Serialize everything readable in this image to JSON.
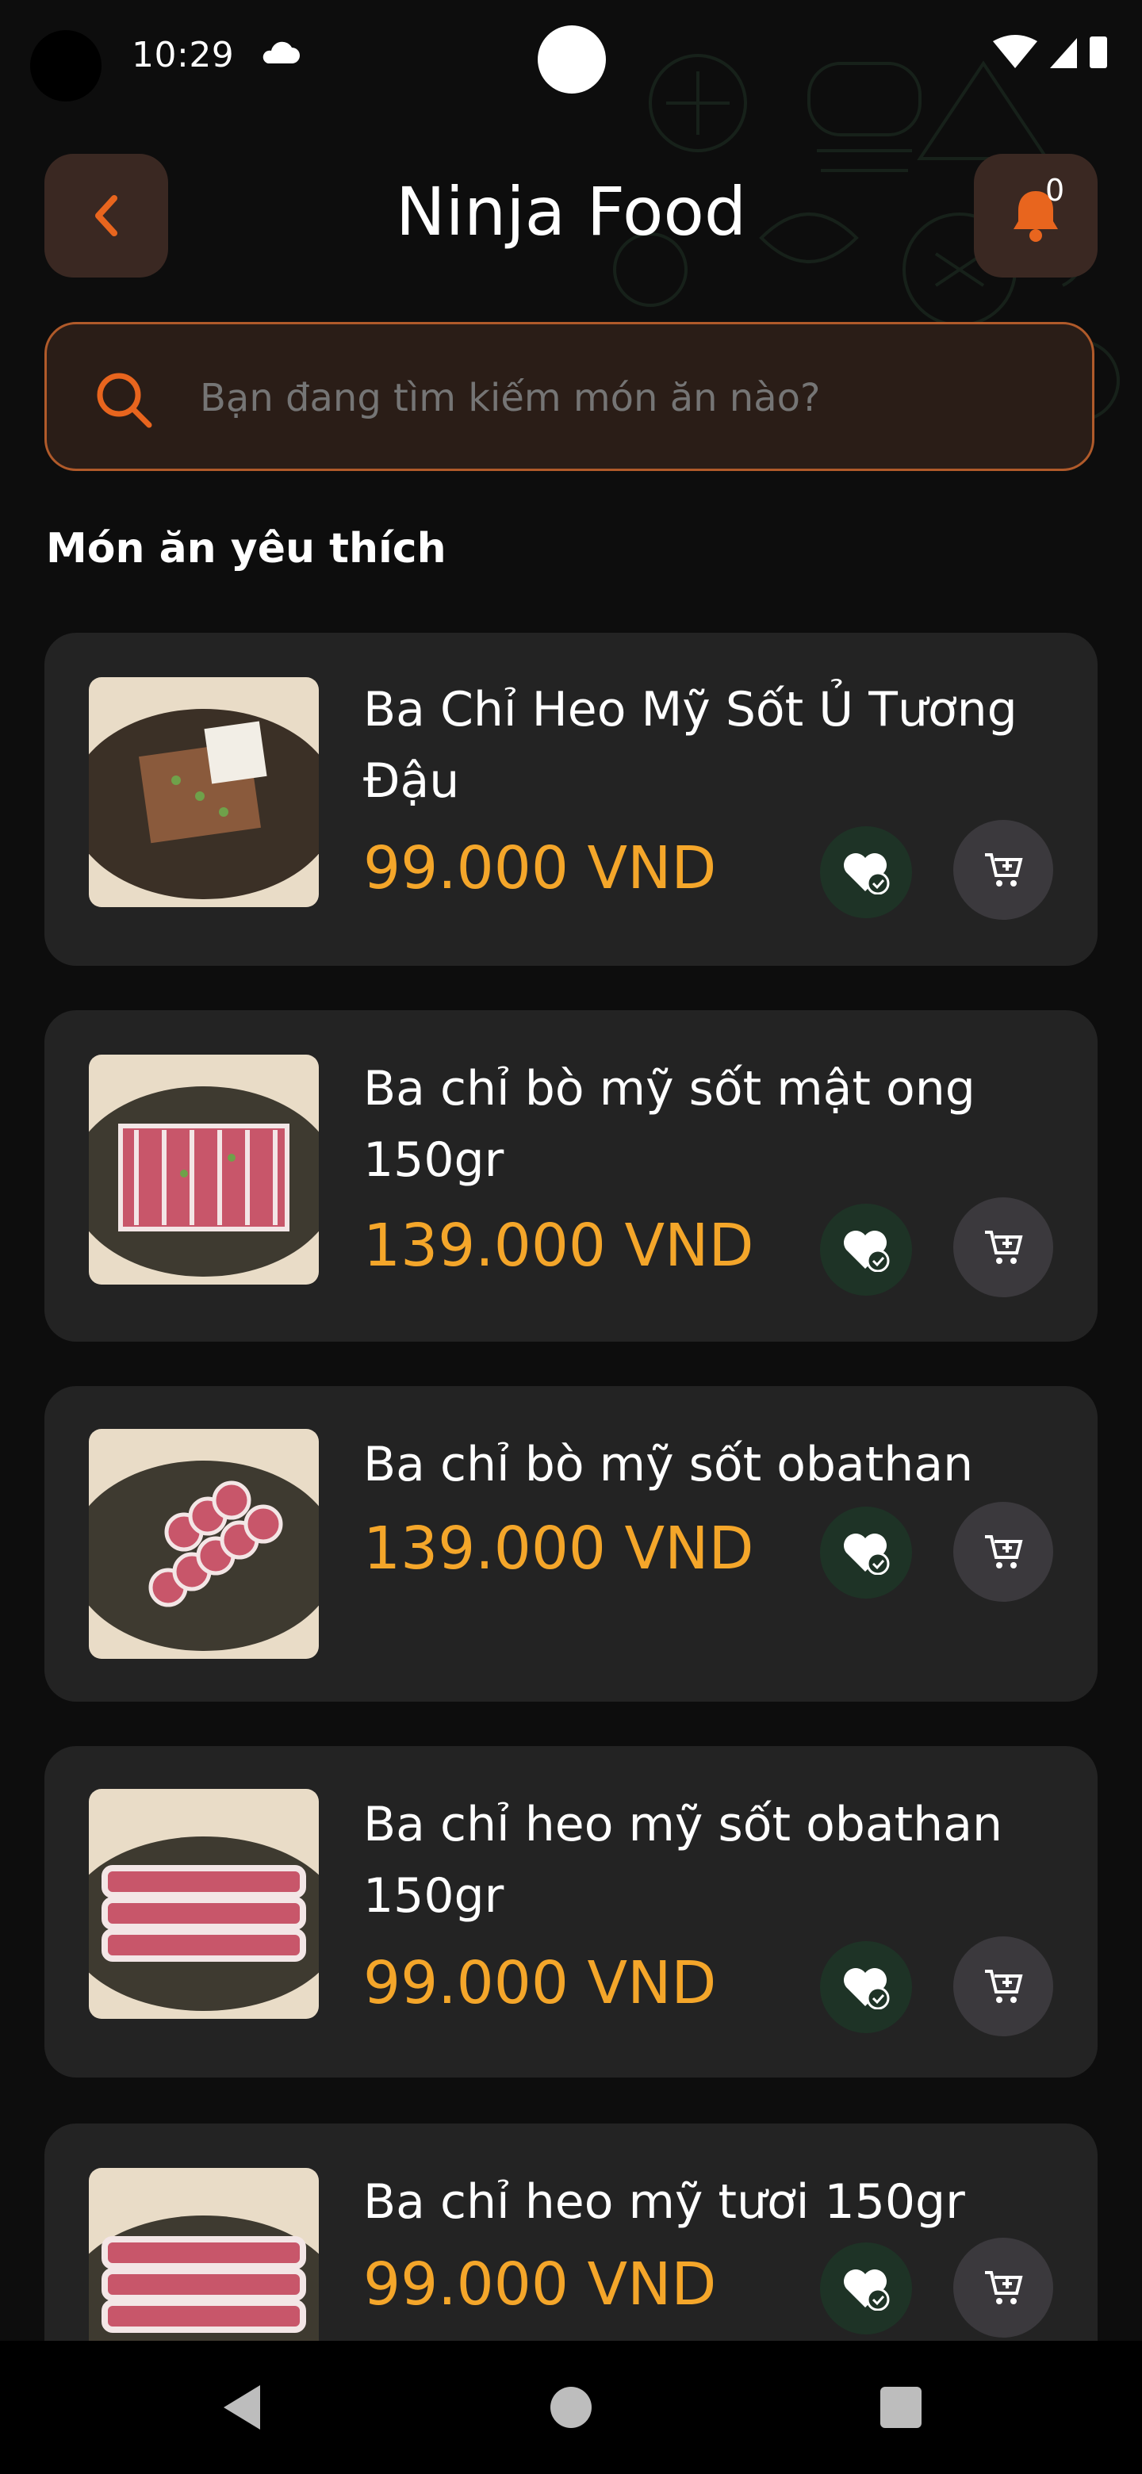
{
  "status_bar": {
    "time": "10:29"
  },
  "header": {
    "title": "Ninja Food",
    "notification_count": "0"
  },
  "search": {
    "placeholder": "Bạn đang tìm kiếm món ăn nào?"
  },
  "section": {
    "title": "Món ăn yêu thích"
  },
  "items": [
    {
      "name": "Ba Chỉ Heo Mỹ Sốt Ủ Tương Đậu",
      "price": "99.000 VND"
    },
    {
      "name": "Ba chỉ bò mỹ sốt mật ong 150gr",
      "price": "139.000 VND"
    },
    {
      "name": "Ba chỉ bò mỹ sốt obathan",
      "price": "139.000 VND"
    },
    {
      "name": "Ba chỉ heo mỹ sốt obathan 150gr",
      "price": "99.000 VND"
    },
    {
      "name": "Ba chỉ heo mỹ tươi 150gr",
      "price": "99.000 VND"
    }
  ],
  "icons": {
    "back": "chevron-left-icon",
    "bell": "bell-icon",
    "search": "search-icon",
    "favorite": "heart-check-icon",
    "cart": "cart-add-icon"
  },
  "colors": {
    "accent": "#e8651e",
    "price": "#f4a62a",
    "card": "#232323",
    "favorite_bg": "#1e3326",
    "cart_bg": "#3b393d"
  }
}
